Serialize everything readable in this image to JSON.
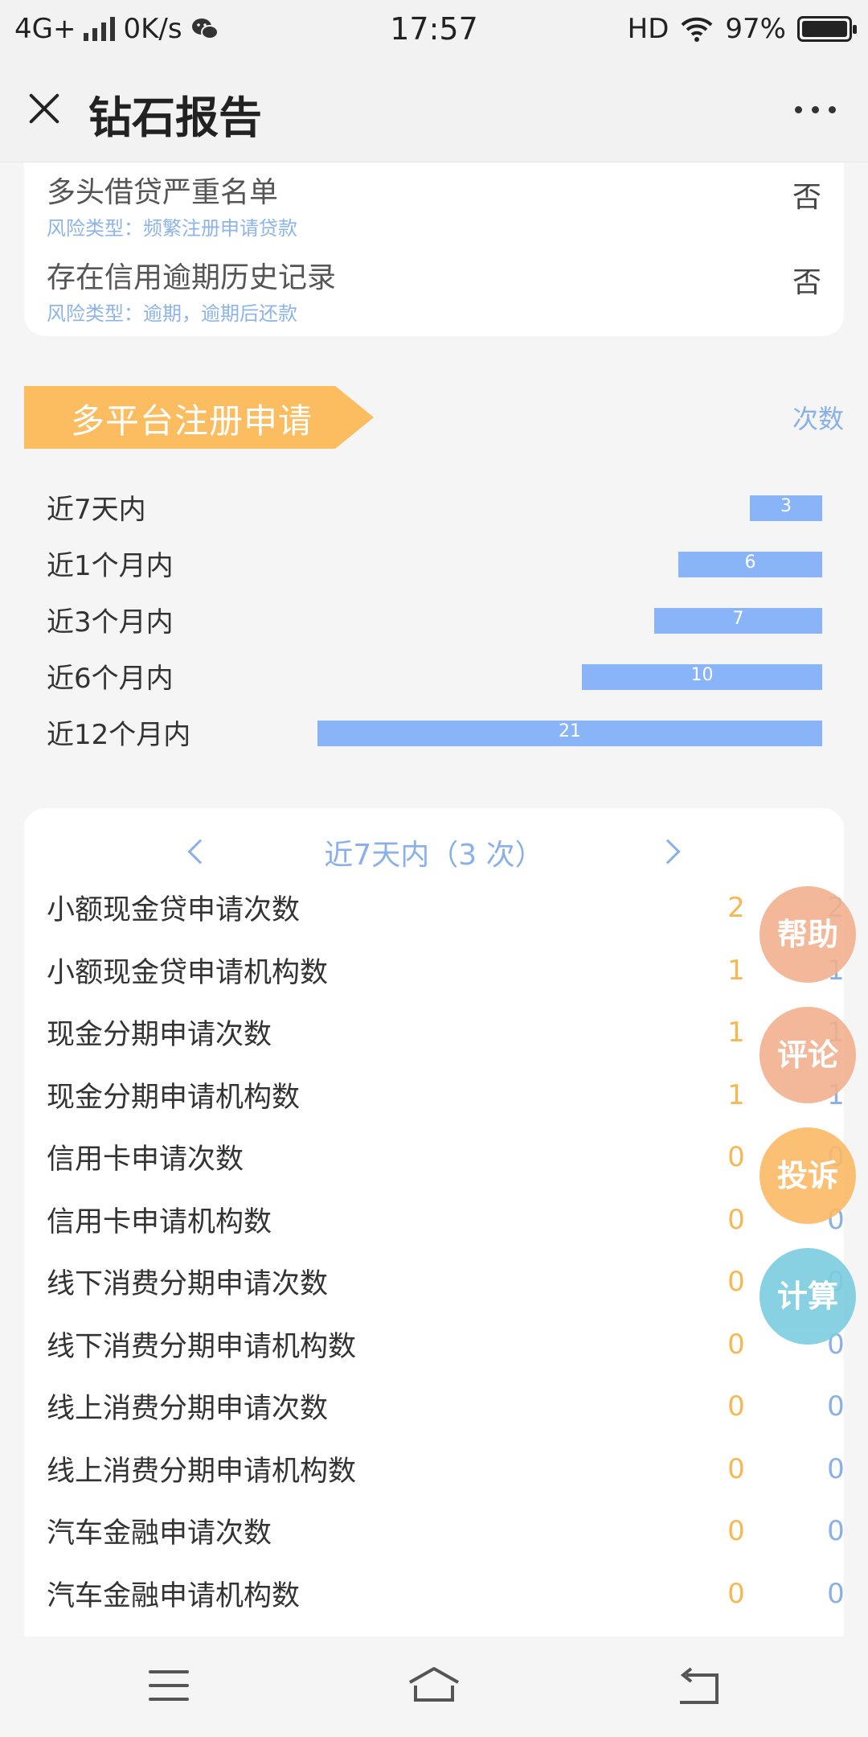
{
  "status_bar": {
    "network": "4G+",
    "speed": "0K/s",
    "time": "17:57",
    "hd": "HD",
    "battery": "97%"
  },
  "title_bar": {
    "title": "钻石报告"
  },
  "risk_items": [
    {
      "name": "多头借贷严重名单",
      "type": "风险类型：频繁注册申请贷款",
      "value": "否"
    },
    {
      "name": "存在信用逾期历史记录",
      "type": "风险类型：逾期，逾期后还款",
      "value": "否"
    }
  ],
  "section": {
    "title": "多平台注册申请",
    "count_label": "次数"
  },
  "chart_data": {
    "type": "bar",
    "categories": [
      "近7天内",
      "近1个月内",
      "近3个月内",
      "近6个月内",
      "近12个月内"
    ],
    "values": [
      3,
      6,
      7,
      10,
      21
    ]
  },
  "detail": {
    "nav_title": "近7天内（3 次）",
    "rows": [
      {
        "label": "小额现金贷申请次数",
        "c1": "2",
        "c2": "2"
      },
      {
        "label": "小额现金贷申请机构数",
        "c1": "1",
        "c2": "1"
      },
      {
        "label": "现金分期申请次数",
        "c1": "1",
        "c2": "1"
      },
      {
        "label": "现金分期申请机构数",
        "c1": "1",
        "c2": "1"
      },
      {
        "label": "信用卡申请次数",
        "c1": "0",
        "c2": "0"
      },
      {
        "label": "信用卡申请机构数",
        "c1": "0",
        "c2": "0"
      },
      {
        "label": "线下消费分期申请次数",
        "c1": "0",
        "c2": "0"
      },
      {
        "label": "线下消费分期申请机构数",
        "c1": "0",
        "c2": "0"
      },
      {
        "label": "线上消费分期申请次数",
        "c1": "0",
        "c2": "0"
      },
      {
        "label": "线上消费分期申请机构数",
        "c1": "0",
        "c2": "0"
      },
      {
        "label": "汽车金融申请次数",
        "c1": "0",
        "c2": "0"
      },
      {
        "label": "汽车金融申请机构数",
        "c1": "0",
        "c2": "0"
      }
    ]
  },
  "floating_buttons": {
    "help": "帮助",
    "comment": "评论",
    "complain": "投诉",
    "calculate": "计算"
  }
}
